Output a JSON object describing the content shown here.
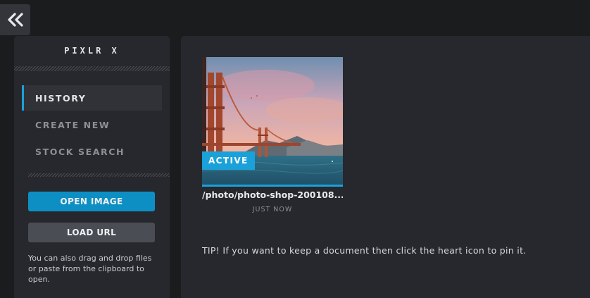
{
  "sidebar": {
    "brand": "PIXLR X",
    "nav": [
      {
        "label": "HISTORY",
        "active": true
      },
      {
        "label": "CREATE NEW",
        "active": false
      },
      {
        "label": "STOCK SEARCH",
        "active": false
      }
    ],
    "open_image_label": "OPEN IMAGE",
    "load_url_label": "LOAD URL",
    "hint": "You can also drag and drop files or paste from the clipboard to open."
  },
  "history": {
    "items": [
      {
        "badge": "ACTIVE",
        "filename": "/photo/photo-shop-200108....",
        "time": "JUST NOW"
      }
    ]
  },
  "tip": "TIP! If you want to keep a document then click the heart icon to pin it.",
  "colors": {
    "accent": "#1ba1d9",
    "open_button": "#0e8fc4",
    "panel": "#26282d",
    "background": "#1b1c1e"
  },
  "icons": {
    "collapse": "double-chevron-left-icon"
  }
}
